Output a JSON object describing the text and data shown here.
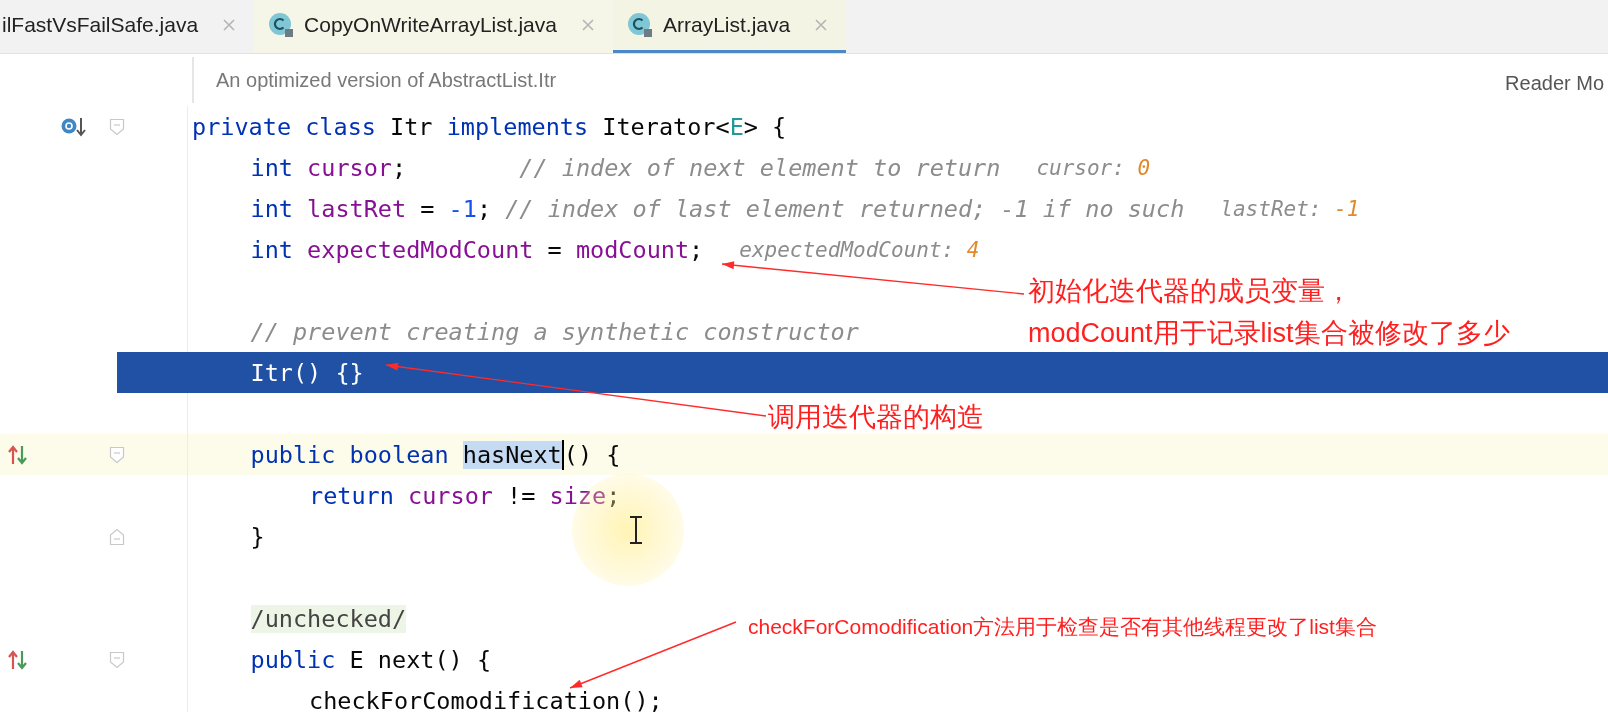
{
  "tabs": [
    {
      "label": "ilFastVsFailSafe.java",
      "selected": false,
      "icon": false
    },
    {
      "label": "CopyOnWriteArrayList.java",
      "selected": false,
      "icon": true
    },
    {
      "label": "ArrayList.java",
      "selected": true,
      "icon": true
    }
  ],
  "doc_comment": "An optimized version of AbstractList.Itr",
  "reader_mode": "Reader Mo",
  "lines": [
    {
      "selected": false,
      "current": false,
      "gutter_icon": {
        "kind": "override"
      },
      "fold_marker": {
        "kind": "start"
      },
      "tokens": [
        {
          "kind": "keyword",
          "text": "private class "
        },
        {
          "kind": "plain",
          "text": "Itr "
        },
        {
          "kind": "keyword",
          "text": "implements "
        },
        {
          "kind": "plain",
          "text": "Iterator<"
        },
        {
          "kind": "type_param",
          "text": "E"
        },
        {
          "kind": "plain",
          "text": "> {"
        }
      ],
      "children": [
        {
          "selected": false,
          "current": false,
          "tokens": [
            {
              "kind": "keyword",
              "text": "int "
            },
            {
              "kind": "field",
              "text": "cursor"
            },
            {
              "kind": "plain",
              "text": ";        "
            },
            {
              "kind": "comment",
              "text": "// index of next element to return"
            }
          ],
          "hint": {
            "label": "cursor: ",
            "value": "0"
          }
        },
        {
          "selected": false,
          "current": false,
          "tokens": [
            {
              "kind": "keyword",
              "text": "int "
            },
            {
              "kind": "field",
              "text": "lastRet"
            },
            {
              "kind": "plain",
              "text": " = "
            },
            {
              "kind": "number",
              "text": "-1"
            },
            {
              "kind": "plain",
              "text": "; "
            },
            {
              "kind": "comment",
              "text": "// index of last element returned; -1 if no such"
            }
          ],
          "hint": {
            "label": "lastRet: ",
            "value": "-1"
          }
        },
        {
          "selected": false,
          "current": false,
          "tokens": [
            {
              "kind": "keyword",
              "text": "int "
            },
            {
              "kind": "field",
              "text": "expectedModCount"
            },
            {
              "kind": "plain",
              "text": " = "
            },
            {
              "kind": "field",
              "text": "modCount"
            },
            {
              "kind": "plain",
              "text": ";"
            }
          ],
          "hint": {
            "label": "expectedModCount: ",
            "value": "4"
          }
        },
        {
          "selected": false,
          "current": false
        },
        {
          "selected": false,
          "current": false,
          "tokens": [
            {
              "kind": "comment",
              "text": "// prevent creating a synthetic constructor"
            }
          ]
        },
        {
          "selected": true,
          "current": false,
          "tokens": [
            {
              "kind": "plain",
              "text": "Itr() {}"
            }
          ]
        },
        {
          "selected": false,
          "current": false
        },
        {
          "selected": false,
          "current": true,
          "gutter_icon": {
            "kind": "implements"
          },
          "fold_marker": {
            "kind": "start"
          },
          "tokens": [
            {
              "kind": "keyword",
              "text": "public boolean "
            },
            {
              "kind": "match",
              "text": "hasNext"
            },
            {
              "kind": "plain",
              "text": "() {"
            }
          ],
          "children": [
            {
              "selected": false,
              "current": false,
              "tokens": [
                {
                  "kind": "keyword",
                  "text": "return "
                },
                {
                  "kind": "field",
                  "text": "cursor"
                },
                {
                  "kind": "plain",
                  "text": " != "
                },
                {
                  "kind": "field",
                  "text": "size"
                },
                {
                  "kind": "plain",
                  "text": ";"
                }
              ]
            }
          ]
        },
        {
          "selected": false,
          "current": false,
          "fold_marker": {
            "kind": "end"
          },
          "tokens": [
            {
              "kind": "plain",
              "text": "}"
            }
          ]
        },
        {
          "selected": false,
          "current": false
        },
        {
          "selected": false,
          "current": false,
          "tokens": [
            {
              "kind": "annotation",
              "text": "/unchecked/"
            }
          ]
        },
        {
          "selected": false,
          "current": false,
          "gutter_icon": {
            "kind": "implements"
          },
          "fold_marker": {
            "kind": "start"
          },
          "tokens": [
            {
              "kind": "keyword",
              "text": "public "
            },
            {
              "kind": "plain",
              "text": "E next() {"
            }
          ],
          "children": [
            {
              "selected": false,
              "current": false,
              "tokens": [
                {
                  "kind": "plain",
                  "text": "checkForComodification();"
                }
              ]
            }
          ]
        }
      ]
    }
  ],
  "annotations": [
    {
      "lines": [
        "初始化迭代器的成员变量，",
        "modCount用于记录list集合被修改了多少"
      ]
    },
    {
      "lines": [
        "调用迭代器的构造"
      ]
    },
    {
      "lines": [
        "checkForComodification方法用于检查是否有其他线程更改了list集合"
      ]
    }
  ]
}
